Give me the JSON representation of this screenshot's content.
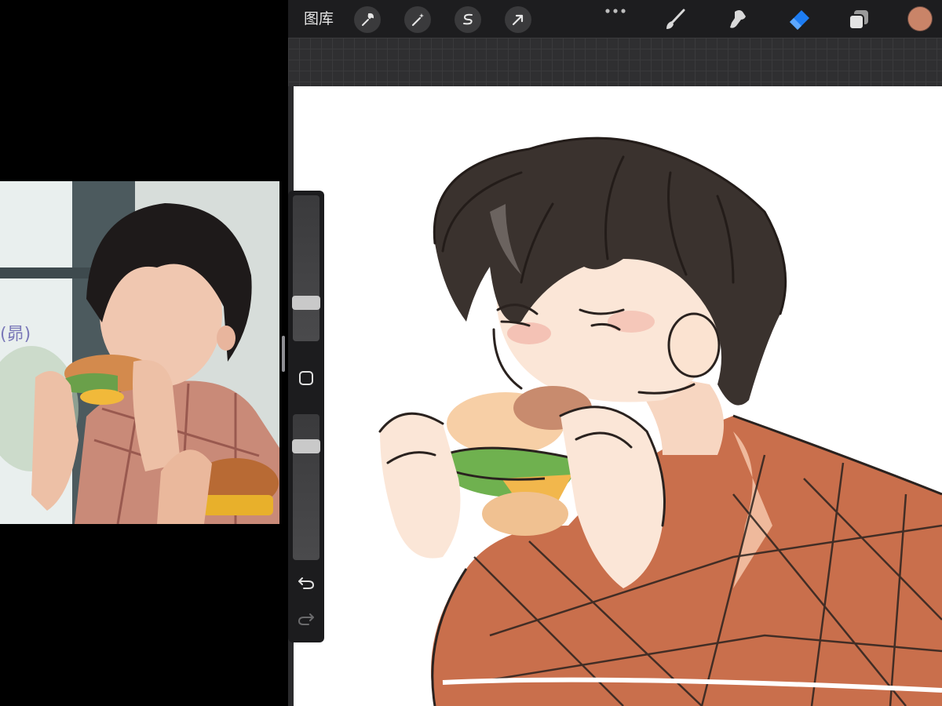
{
  "reference": {
    "caption": "(昴)"
  },
  "toolbar": {
    "gallery_label": "图库",
    "left_tools": [
      {
        "name": "actions",
        "icon": "wrench-icon"
      },
      {
        "name": "adjustments",
        "icon": "magic-wand-icon"
      },
      {
        "name": "selection",
        "icon": "selection-s-icon"
      },
      {
        "name": "transform",
        "icon": "arrow-cursor-icon"
      }
    ],
    "more_icon": "more-dots-icon",
    "right_tools": [
      {
        "name": "brush",
        "icon": "brush-icon",
        "active": false
      },
      {
        "name": "smudge",
        "icon": "smudge-icon",
        "active": false
      },
      {
        "name": "eraser",
        "icon": "eraser-icon",
        "active": true
      },
      {
        "name": "layers",
        "icon": "layers-icon",
        "active": false
      }
    ],
    "current_color": "#c98468",
    "active_color": "#1d7cf2"
  },
  "sidebar": {
    "brush_size_level": 0.4,
    "opacity_level": 0.8,
    "modify_icon": "square-icon",
    "undo_icon": "undo-arrow-icon",
    "redo_icon": "redo-arrow-icon"
  }
}
